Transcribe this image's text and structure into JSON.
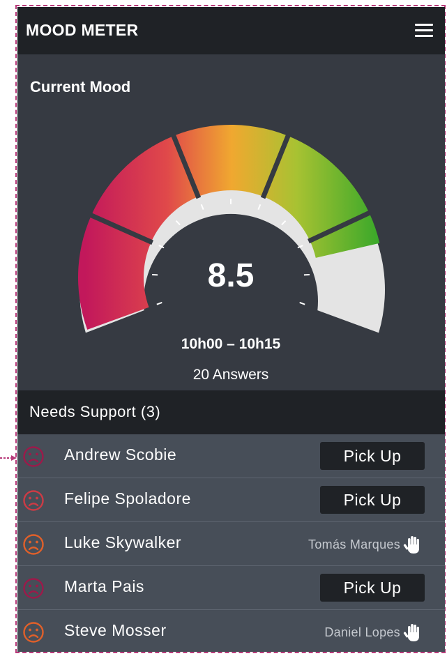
{
  "header": {
    "title": "MOOD METER",
    "menu_icon": "hamburger-menu-icon"
  },
  "gauge": {
    "title": "Current Mood",
    "value": "8.5",
    "mood_level": 8.5,
    "scale_max": 10,
    "time_range": "10h00 – 10h15",
    "answers": "20 Answers",
    "colors": {
      "low": "#c2185b",
      "mid": "#f0a830",
      "high": "#4caf2e",
      "track": "#e4e4e4"
    }
  },
  "support": {
    "title": "Needs Support (3)",
    "rows": [
      {
        "name": "Andrew Scobie",
        "face_color": "#9c1a4a",
        "action": "Pick Up",
        "assignee": ""
      },
      {
        "name": "Felipe Spoladore",
        "face_color": "#cc3b45",
        "action": "Pick Up",
        "assignee": ""
      },
      {
        "name": "Luke Skywalker",
        "face_color": "#e0602a",
        "action": "",
        "assignee": "Tomás Marques"
      },
      {
        "name": "Marta Pais",
        "face_color": "#9c1a4a",
        "action": "Pick Up",
        "assignee": ""
      },
      {
        "name": "Steve Mosser",
        "face_color": "#e0602a",
        "action": "",
        "assignee": "Daniel Lopes"
      }
    ]
  }
}
